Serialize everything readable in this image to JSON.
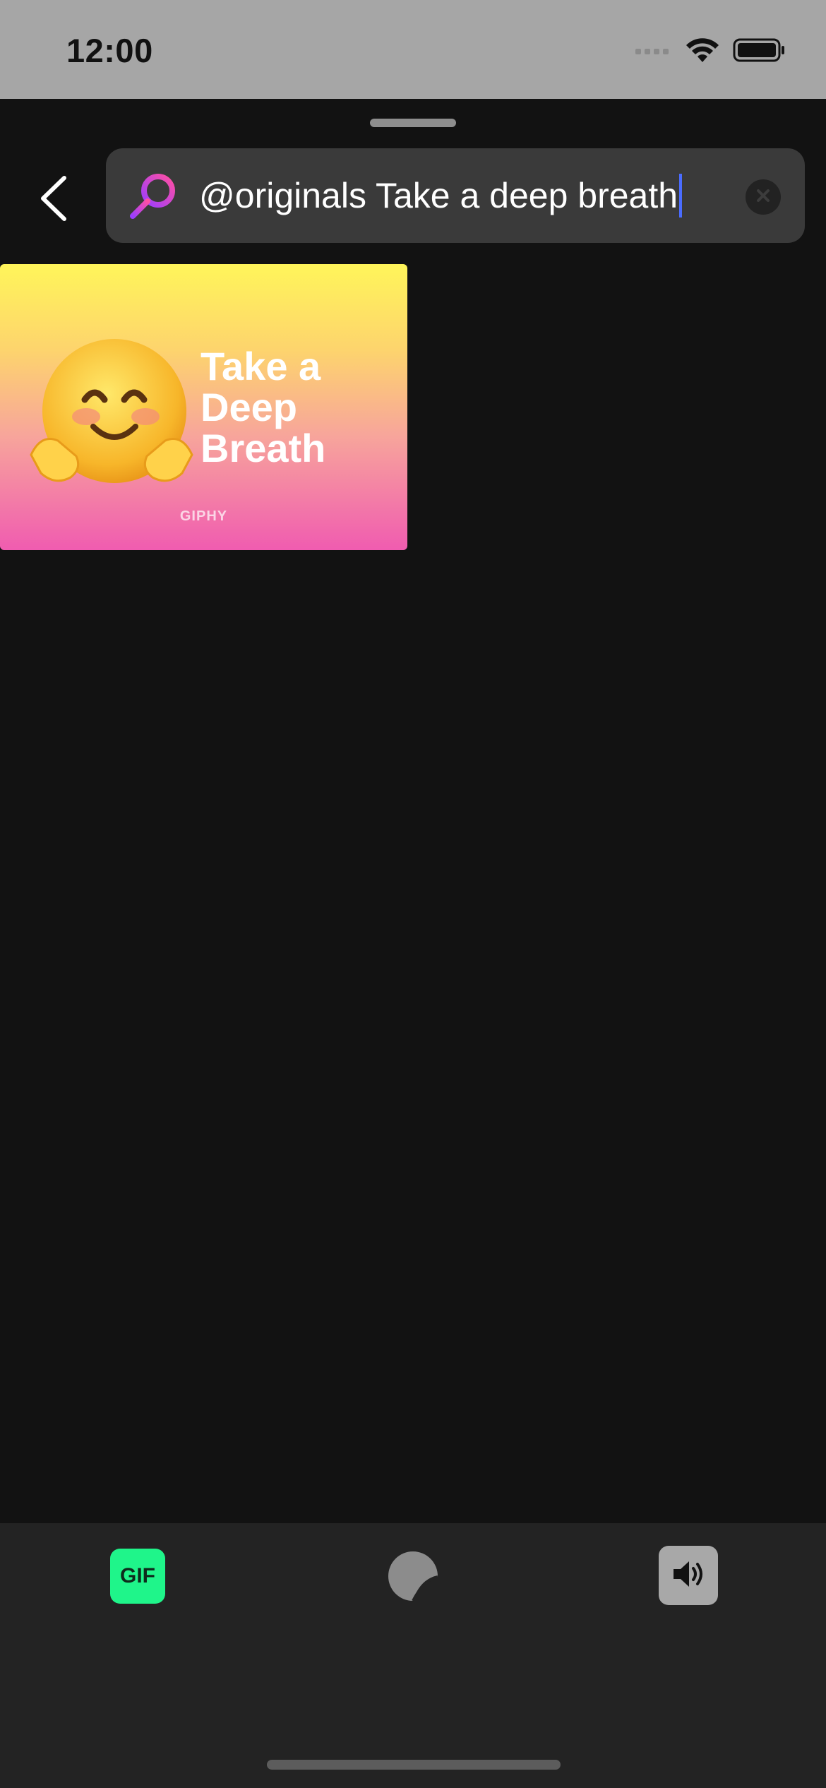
{
  "status_bar": {
    "time": "12:00",
    "icons": [
      "cellular-signal-icon",
      "wifi-icon",
      "battery-icon"
    ]
  },
  "search": {
    "query": "@originals Take a deep breath",
    "icons": {
      "search": "search-icon",
      "clear": "clear-icon",
      "back": "chevron-left-icon"
    }
  },
  "results": [
    {
      "title_lines": [
        "Take a",
        "Deep",
        "Breath"
      ],
      "watermark": "GIPHY",
      "icon": "hugging-face-emoji"
    }
  ],
  "bottom_tabs": {
    "gif_label": "GIF",
    "icons": [
      "gif-tab",
      "sticker-icon",
      "speaker-icon"
    ]
  },
  "colors": {
    "accent_green": "#1ff58a",
    "caret_blue": "#4a6cff",
    "search_gradient_start": "#9b3dff",
    "search_gradient_end": "#ff4fa3"
  }
}
